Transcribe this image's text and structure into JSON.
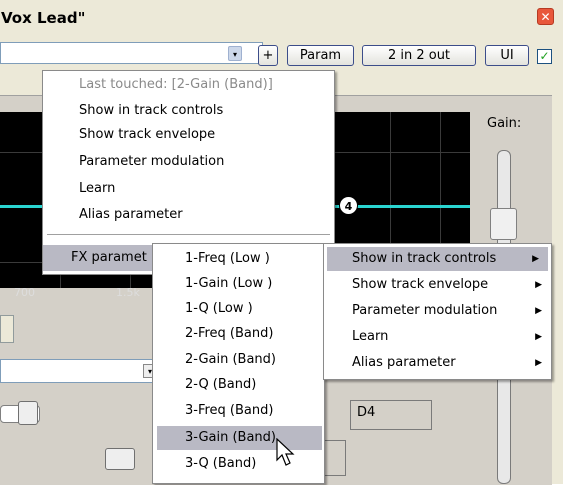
{
  "window": {
    "title": "Vox Lead\"",
    "close_glyph": "✕"
  },
  "toolbar": {
    "dropdown_glyph": "▾",
    "add_label": "+",
    "param_label": "Param",
    "io_label": "2 in 2 out",
    "ui_label": "UI",
    "enabled_glyph": "✓"
  },
  "plugin": {
    "gain_label": "Gain:",
    "node_label": "4",
    "axis_ticks": [
      "700",
      "1.5k"
    ],
    "combo_glyph": "▾",
    "note_field": "D4"
  },
  "param_menu": {
    "header": "Last touched: [2-Gain (Band)]",
    "items": [
      "Show in track controls",
      "Show track envelope",
      "Parameter modulation",
      "Learn",
      "Alias parameter"
    ],
    "fx_parameters": "FX paramet"
  },
  "fx_param_list": {
    "items": [
      "1-Freq (Low )",
      "1-Gain (Low )",
      "1-Q (Low )",
      "2-Freq (Band)",
      "2-Gain (Band)",
      "2-Q (Band)",
      "3-Freq (Band)",
      "3-Gain (Band)",
      "3-Q (Band)"
    ],
    "highlighted": "3-Gain (Band)"
  },
  "action_menu": {
    "items": [
      "Show in track controls",
      "Show track envelope",
      "Parameter modulation",
      "Learn",
      "Alias parameter"
    ],
    "highlighted": "Show in track controls"
  }
}
